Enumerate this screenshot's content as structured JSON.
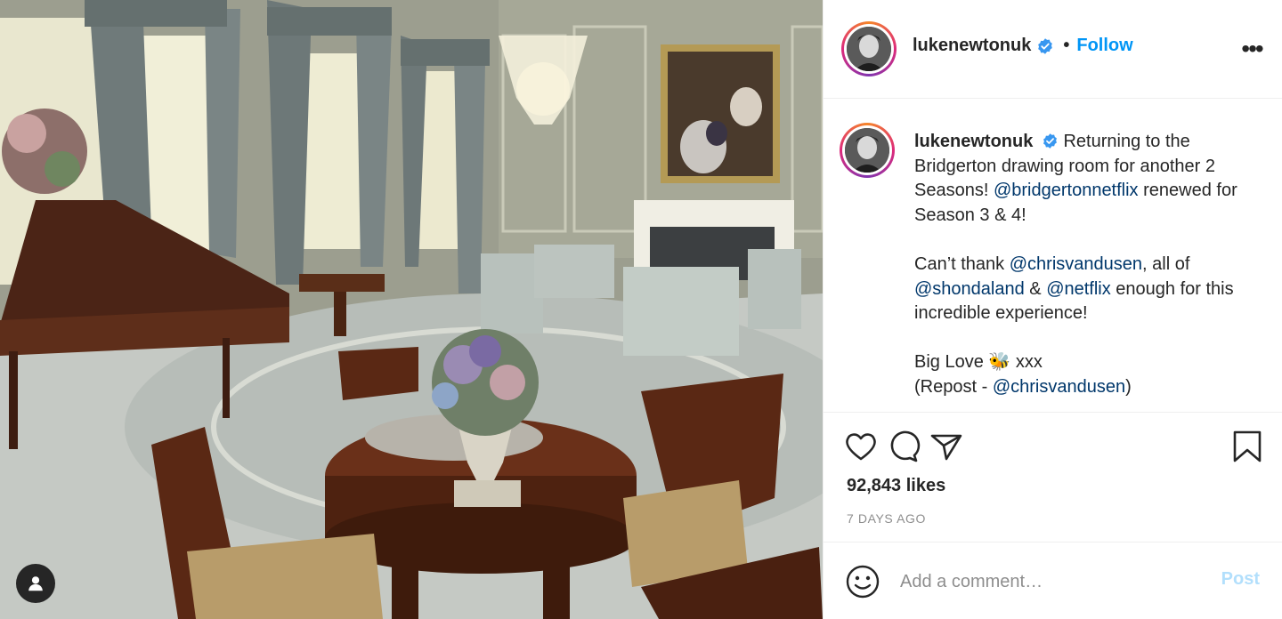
{
  "post": {
    "username": "lukenewtonuk",
    "follow_label": "Follow",
    "separator": "•",
    "more_label": "•••",
    "caption": {
      "username": "lukenewtonuk",
      "line1_text": " Returning to the Bridgerton drawing room for another 2 Seasons! ",
      "mention1": "@bridgertonnetflix",
      "line2_text": " renewed for Season 3 & 4!",
      "line3_text": "Can’t thank ",
      "mention2": "@chrisvandusen",
      "line3b_text": ", all of ",
      "mention3": "@shondaland",
      "line3c_text": " & ",
      "mention4": "@netflix",
      "line3d_text": " enough for this incredible experience!",
      "line4_text": "Big Love 🐝 xxx",
      "line5_text": "(Repost - ",
      "mention5": "@chrisvandusen",
      "line5b_text": ")"
    },
    "likes": "92,843 likes",
    "time": "7 DAYS AGO",
    "comment": {
      "placeholder": "Add a comment…",
      "post_label": "Post"
    }
  },
  "colors": {
    "accent": "#0095f6",
    "mention": "#00376b",
    "post_disabled": "#b2dffc",
    "muted": "#8e8e8e"
  },
  "icons": [
    "verified-badge-icon",
    "more-options-icon",
    "heart-icon",
    "comment-icon",
    "share-icon",
    "bookmark-icon",
    "emoji-icon",
    "user-tag-icon"
  ]
}
